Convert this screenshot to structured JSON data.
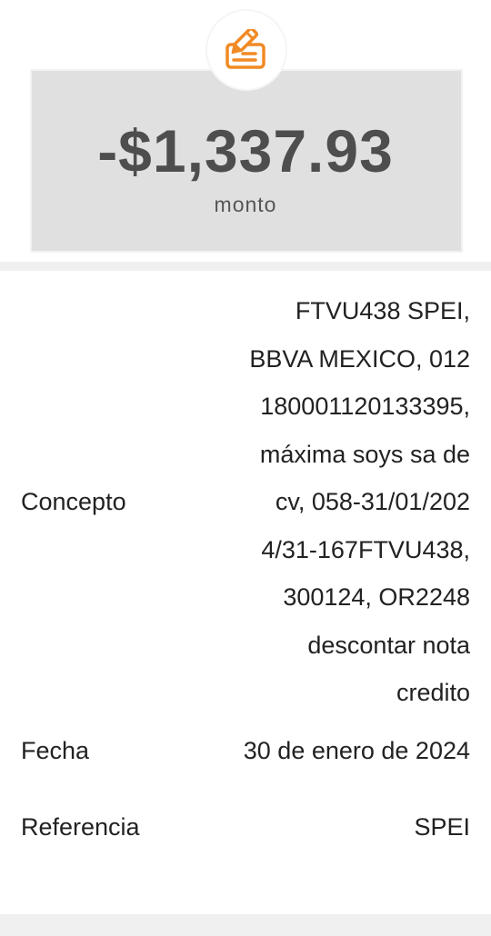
{
  "header": {
    "icon": "edit-document-icon",
    "amount": "-$1,337.93",
    "amount_label": "monto"
  },
  "colors": {
    "accent": "#f08a24",
    "card_bg": "#e0e0e0",
    "amount_text": "#4e4e4e"
  },
  "details": {
    "concepto": {
      "label": "Concepto",
      "value_lines": [
        "FTVU438 SPEI,",
        "BBVA MEXICO, 012",
        "180001120133395,",
        "máxima soys sa de",
        "cv, 058-31/01/202",
        "4/31-167FTVU438,",
        "300124, OR2248",
        "descontar nota",
        "credito"
      ]
    },
    "fecha": {
      "label": "Fecha",
      "value": "30 de enero de 2024"
    },
    "referencia": {
      "label": "Referencia",
      "value": "SPEI"
    }
  }
}
